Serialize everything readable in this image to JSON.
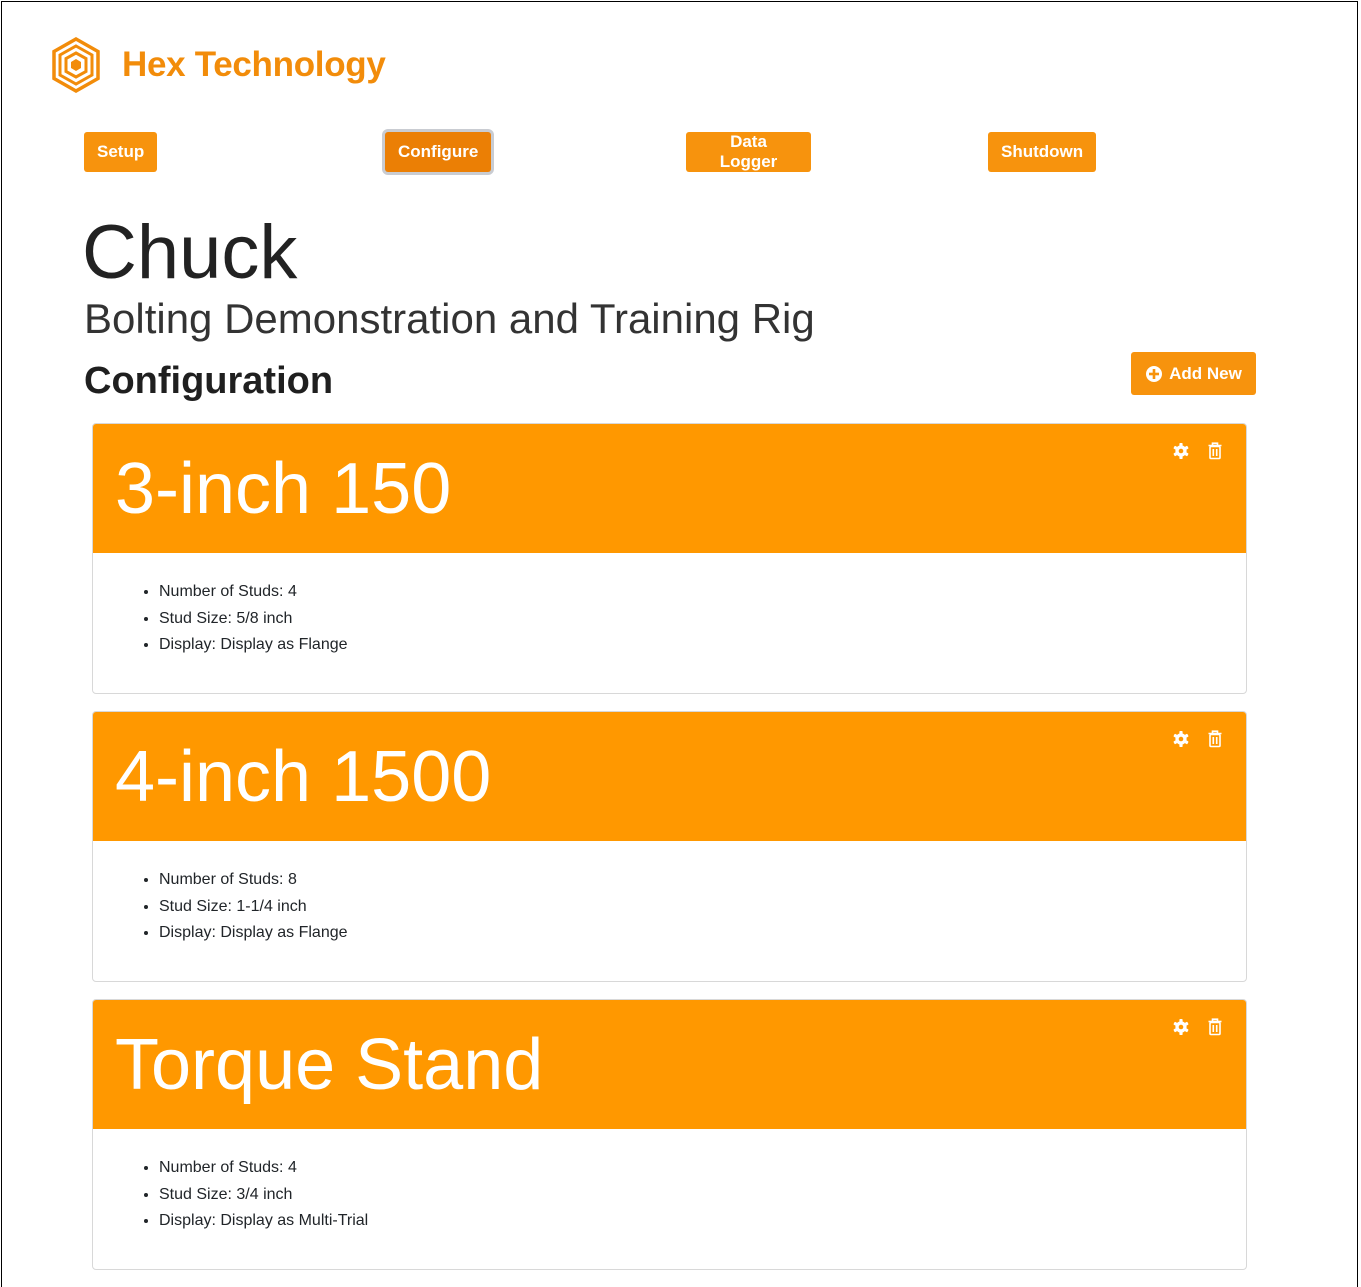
{
  "brand": {
    "name": "Hex Technology",
    "color": "#f28c0a",
    "logo_icon": "hexagon-logo-icon"
  },
  "nav": {
    "items": [
      {
        "label": "Setup",
        "active": false
      },
      {
        "label": "Configure",
        "active": true
      },
      {
        "label": "Data Logger",
        "active": false
      },
      {
        "label": "Shutdown",
        "active": false
      }
    ]
  },
  "page": {
    "title": "Chuck",
    "subtitle": "Bolting Demonstration and Training Rig",
    "section_title": "Configuration",
    "add_new_label": "Add New",
    "add_new_icon": "plus-circle-icon"
  },
  "configurations": [
    {
      "name": "3-inch 150",
      "details": [
        "Number of Studs: 4",
        "Stud Size: 5/8 inch",
        "Display: Display as Flange"
      ]
    },
    {
      "name": "4-inch 1500",
      "details": [
        "Number of Studs: 8",
        "Stud Size: 1-1/4 inch",
        "Display: Display as Flange"
      ]
    },
    {
      "name": "Torque Stand",
      "details": [
        "Number of Studs: 4",
        "Stud Size: 3/4 inch",
        "Display: Display as Multi-Trial"
      ]
    }
  ],
  "card_action_icons": [
    "gear-icon",
    "trash-icon"
  ],
  "colors": {
    "accent": "#ff9800",
    "button": "#f7930d",
    "button_active": "#eb7f05"
  }
}
